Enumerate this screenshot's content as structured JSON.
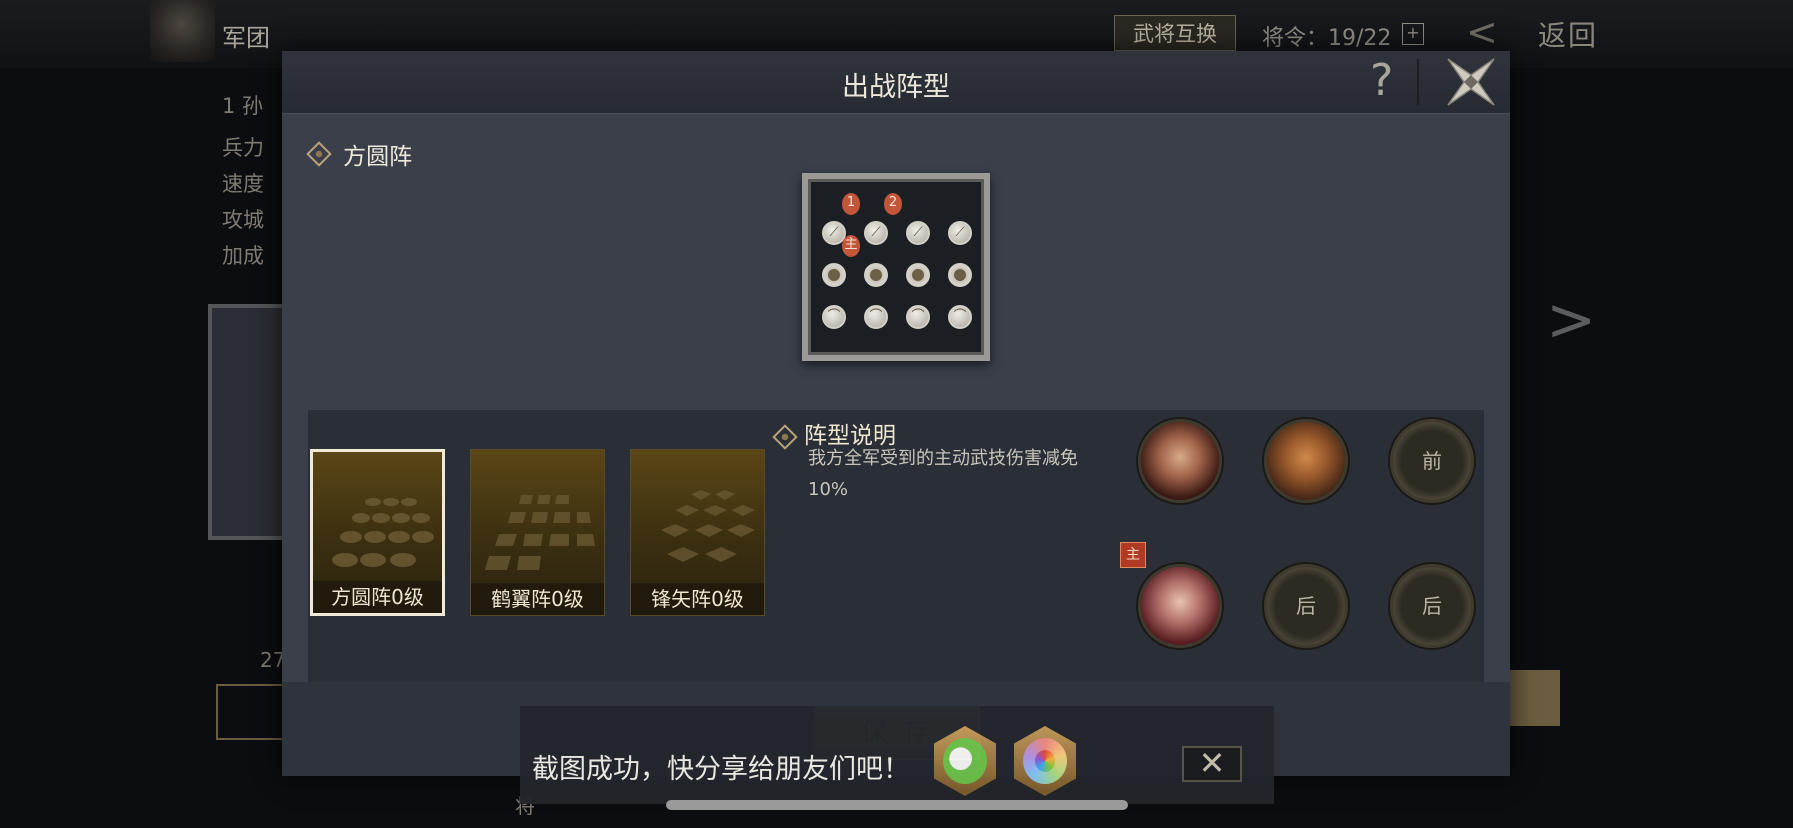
{
  "background": {
    "top_title": "军团",
    "swap_button": "武将互换",
    "orders_label": "将令：19/22",
    "orders_plus": "+",
    "back_label": "返回",
    "left_items": [
      "1 孙",
      "兵力",
      "速度",
      "攻城",
      "加成"
    ],
    "left_number": "27",
    "bottom_label": "将"
  },
  "modal": {
    "title": "出战阵型",
    "help_symbol": "?",
    "current_formation": "方圆阵",
    "board": {
      "markers": [
        "1",
        "2",
        "主"
      ]
    },
    "description": {
      "title": "阵型说明",
      "text": "我方全军受到的主动武技伤害减免10%"
    },
    "formations": [
      {
        "label": "方圆阵0级",
        "selected": true
      },
      {
        "label": "鹤翼阵0级",
        "selected": false
      },
      {
        "label": "锋矢阵0级",
        "selected": false
      }
    ],
    "slots": [
      {
        "type": "hero",
        "label": ""
      },
      {
        "type": "hero",
        "label": ""
      },
      {
        "type": "empty",
        "label": "前"
      },
      {
        "type": "hero",
        "label": "",
        "lord_badge": "主"
      },
      {
        "type": "empty",
        "label": "后"
      },
      {
        "type": "empty",
        "label": "后"
      }
    ],
    "save_button": "保 存"
  },
  "toast": {
    "text": "截图成功，快分享给朋友们吧！",
    "share_icons": [
      "wechat-icon",
      "moments-icon"
    ],
    "close_symbol": "✕"
  },
  "colors": {
    "modal_bg": "#3a3f4a",
    "card_gold": "#5a4616",
    "save_gold": "#a6946d",
    "marker_red": "#c2553a"
  }
}
